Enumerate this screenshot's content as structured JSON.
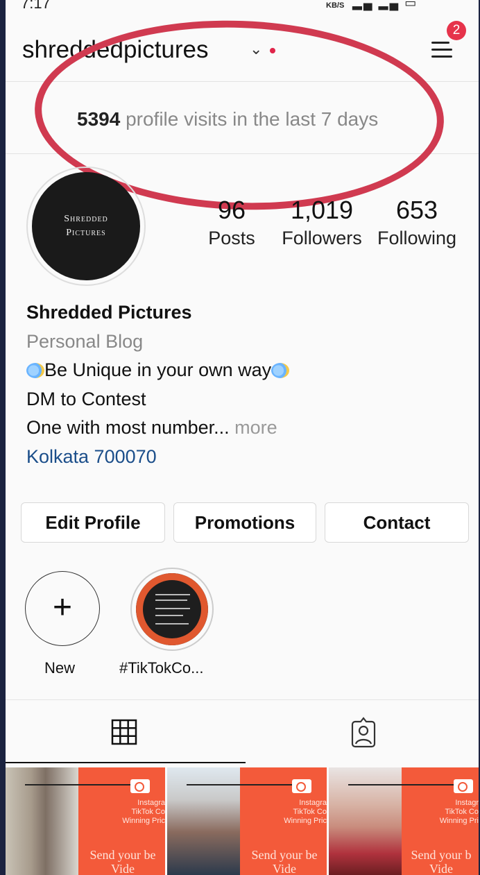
{
  "status_bar": {
    "time": "7:17",
    "net_speed": "KB/S"
  },
  "header": {
    "username": "shreddedpictures",
    "notification_count": "2"
  },
  "profile_visits": {
    "count": "5394",
    "label": "profile visits in the last 7 days"
  },
  "avatar": {
    "line1": "Shredded",
    "line2": "Pictures"
  },
  "stats": [
    {
      "value": "96",
      "label": "Posts"
    },
    {
      "value": "1,019",
      "label": "Followers"
    },
    {
      "value": "653",
      "label": "Following"
    }
  ],
  "bio": {
    "name": "Shredded Pictures",
    "category": "Personal Blog",
    "line1": "Be Unique in your own way",
    "line2": "DM to Contest",
    "line3": "One with most number...",
    "more": "more",
    "location": "Kolkata 700070"
  },
  "buttons": {
    "edit_profile": "Edit Profile",
    "promotions": "Promotions",
    "contact": "Contact"
  },
  "highlights": [
    {
      "label": "New"
    },
    {
      "label": "#TikTokCo..."
    }
  ],
  "grid": [
    {
      "overlay_line1": "Instagra",
      "overlay_line2": "TikTok Co",
      "overlay_line3": "Winning Pric",
      "overlay_line4": "Send your be",
      "overlay_line5": "Vide"
    },
    {
      "overlay_line1": "Instagra",
      "overlay_line2": "TikTok Co",
      "overlay_line3": "Winning Pric",
      "overlay_line4": "Send your be",
      "overlay_line5": "Vide"
    },
    {
      "overlay_line1": "Instagr",
      "overlay_line2": "TikTok Co",
      "overlay_line3": "Winning Pri",
      "overlay_line4": "Send your b",
      "overlay_line5": "Vide"
    }
  ],
  "colors": {
    "highlight_ring": "#d03a50",
    "badge": "#e6334b",
    "location_link": "#1b4e8a",
    "post_overlay": "#f35a3a"
  },
  "icons": {
    "menu": "hamburger-menu-icon",
    "grid_tab": "grid-icon",
    "tagged_tab": "tagged-person-icon",
    "add_highlight": "plus-icon"
  }
}
